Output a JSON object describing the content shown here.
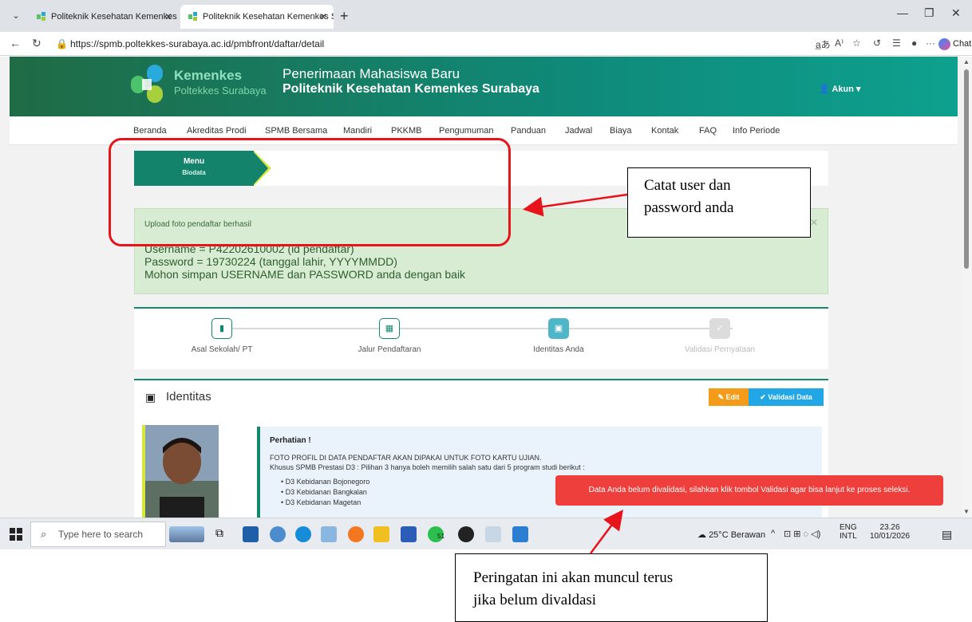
{
  "browser": {
    "tabs": [
      {
        "title": "Politeknik Kesehatan Kemenkes Su",
        "active": false
      },
      {
        "title": "Politeknik Kesehatan Kemenkes Su",
        "active": true
      }
    ],
    "url": "https://spmb.poltekkes-surabaya.ac.id/pmbfront/daftar/detail",
    "chat_label": "Chat"
  },
  "header": {
    "logo_name": "Kemenkes",
    "logo_sub": "Poltekkes Surabaya",
    "line1": "Penerimaan Mahasiswa Baru",
    "line2": "Politeknik Kesehatan Kemenkes Surabaya",
    "account_label": "Akun"
  },
  "nav": [
    "Beranda",
    "Akreditas Prodi",
    "SPMB Bersama",
    "Mandiri",
    "PKKMB",
    "Pengumuman",
    "Panduan",
    "Jadwal",
    "Biaya",
    "Kontak",
    "FAQ",
    "Info Periode"
  ],
  "menu": {
    "title": "Menu",
    "subtitle": "Biodata"
  },
  "alert": {
    "small": "Upload foto pendaftar berhasil",
    "username": "Username = P42202610002 (id pendaftar)",
    "password": "Password = 19730224 (tanggal lahir, YYYYMMDD)",
    "note": "Mohon simpan USERNAME dan PASSWORD anda dengan baik"
  },
  "steps": [
    {
      "label": "Asal Sekolah/ PT",
      "state": "done"
    },
    {
      "label": "Jalur Pendaftaran",
      "state": "done"
    },
    {
      "label": "Identitas Anda",
      "state": "current"
    },
    {
      "label": "Validasi Pernyataan",
      "state": "disabled"
    }
  ],
  "card": {
    "title": "Identitas",
    "edit_label": "Edit",
    "validate_label": "Validasi Data",
    "notice_title": "Perhatian !",
    "notice_line1": "FOTO PROFIL DI DATA PENDAFTAR AKAN DIPAKAI UNTUK FOTO KARTU UJIAN.",
    "notice_line2": "Khusus SPMB Prestasi D3 : Pilihan 3 hanya boleh memilih salah satu dari 5 program studi berikut :",
    "bullets": [
      "D3 Kebidanan Bojonegoro",
      "D3 Kebidanan Bangkalan",
      "D3 Kebidanan Magetan"
    ]
  },
  "toast": "Data Anda belum divalidasi, silahkan klik tombol Validasi agar bisa lanjut ke proses seleksi.",
  "taskbar": {
    "search_placeholder": "Type here to search",
    "weather": "25°C Berawan",
    "lang1": "ENG",
    "lang2": "INTL",
    "time": "23.26",
    "date": "10/01/2026",
    "whatsapp_badge": "51"
  },
  "annotations": {
    "callout1": [
      "Catat user dan",
      "password anda"
    ],
    "callout2": [
      "Peringatan ini akan muncul terus",
      "jika belum divaldasi"
    ]
  },
  "colors": {
    "accent": "#12896f",
    "alert_bg": "#d7ecd3",
    "toast_bg": "#ef3f3c",
    "annotation_red": "#e8141c"
  }
}
